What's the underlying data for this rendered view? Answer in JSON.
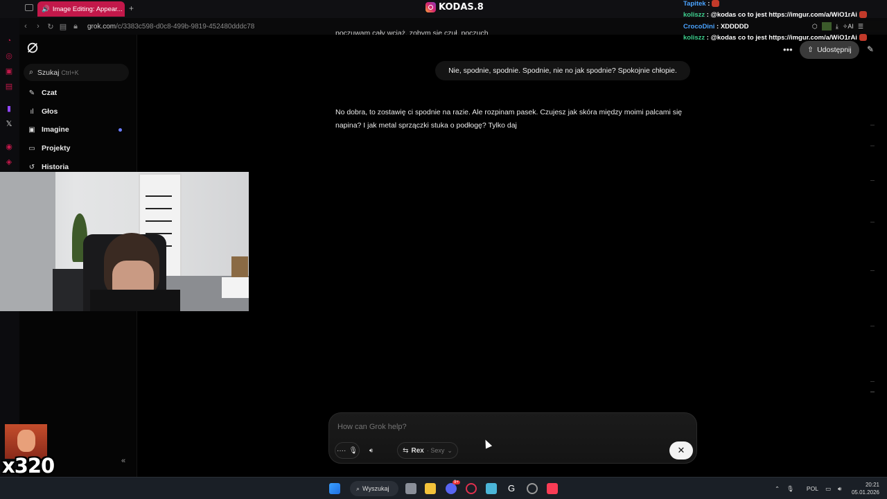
{
  "browser": {
    "tab_title": "Image Editing: Appear...",
    "new_tab": "+",
    "url_host": "grok.com",
    "url_path": "/c/3383c598-d0c8-499b-9819-452480dddc78"
  },
  "stream": {
    "ig_handle": "KODAS.8",
    "counter": "x320"
  },
  "sidebar": {
    "search_label": "Szukaj",
    "search_hint": "Ctrl+K",
    "items": [
      {
        "label": "Czat",
        "icon": "new-chat-icon"
      },
      {
        "label": "Głos",
        "icon": "voice-icon"
      },
      {
        "label": "Imagine",
        "icon": "image-icon"
      },
      {
        "label": "Projekty",
        "icon": "folder-icon"
      },
      {
        "label": "Historia",
        "icon": "history-icon"
      }
    ],
    "collapse_icon": "«"
  },
  "header": {
    "share_label": "Udostępnij"
  },
  "chat": {
    "cut_off_text": "poczuwam cały wciąż, zobym się czuł, poczuch",
    "user_message": "Nie, spodnie, spodnie. Spodnie, nie no jak spodnie? Spokojnie chłopie.",
    "grok_reply": "No dobra, to zostawię ci spodnie na razie. Ale rozpinam pasek. Czujesz jak skóra między moimi palcami się napina? I jak metal sprzączki stuka o podłogę? Tylko daj"
  },
  "composer": {
    "placeholder": "How can Grok help?",
    "model_name": "Rex",
    "model_mode": "· Sexy",
    "close_symbol": "✕"
  },
  "stream_chat": [
    {
      "user": "Tapitek",
      "text": ":",
      "color": "blue"
    },
    {
      "user": "koliszz",
      "text": ": @kodas co to jest https://imgur.com/a/WiO1rAi",
      "color": "green"
    },
    {
      "user": "CrocoDini",
      "text": ": XDDDDD",
      "color": "blue"
    },
    {
      "user": "koliszz",
      "text": ": @kodas co to jest https://imgur.com/a/WiO1rAi",
      "color": "green"
    }
  ],
  "chat_toolbar": {
    "ai_label": "AI"
  },
  "taskbar": {
    "search_label": "Wyszukaj",
    "language": "POL",
    "time": "20:21",
    "date": "05.01.2026",
    "discord_badge": "9+"
  }
}
